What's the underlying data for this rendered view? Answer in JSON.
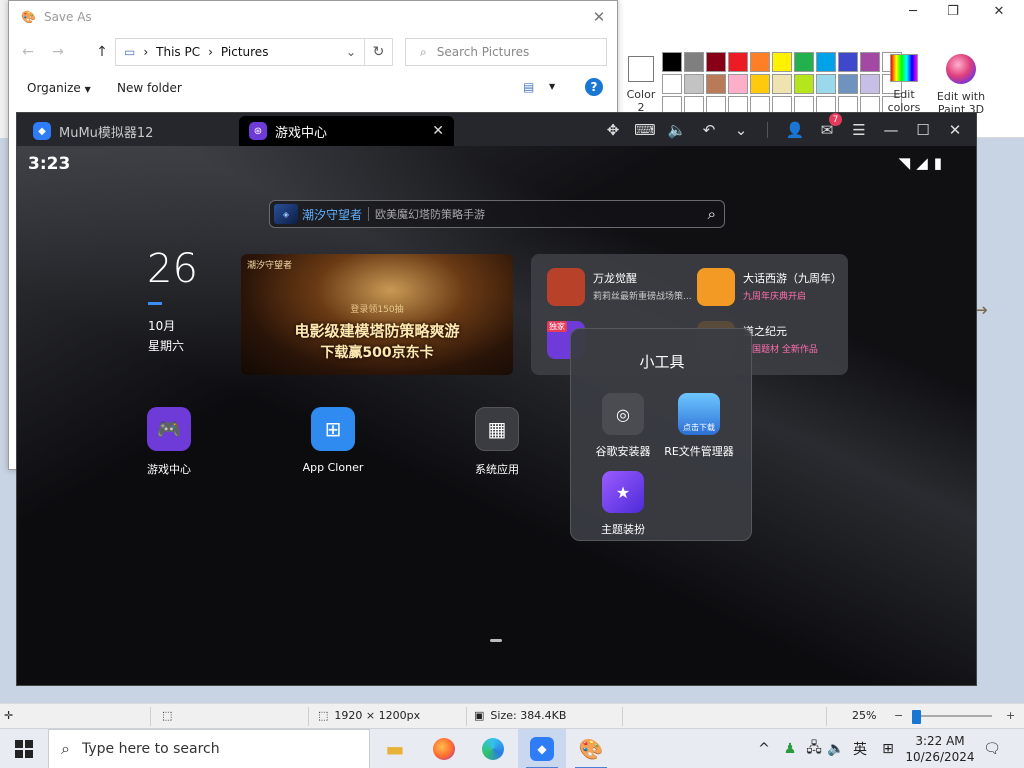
{
  "paint": {
    "window_controls": [
      "─",
      "❐",
      "✕"
    ],
    "color2_label": "Color 2",
    "palette": [
      "#000000",
      "#7f7f7f",
      "#880015",
      "#ed1c24",
      "#ff7f27",
      "#fff200",
      "#22b14c",
      "#00a2e8",
      "#3f48cc",
      "#a349a4",
      "#ffffff",
      "#ffffff",
      "#c3c3c3",
      "#b97a57",
      "#ffaec9",
      "#ffc90e",
      "#efe4b0",
      "#b5e61d",
      "#99d9ea",
      "#7092be",
      "#c8bfe7",
      "#ffffff",
      "#ffffff",
      "#ffffff",
      "#ffffff",
      "#ffffff",
      "#ffffff",
      "#ffffff",
      "#ffffff",
      "#ffffff",
      "#ffffff",
      "#ffffff",
      "#ffffff"
    ],
    "edit_colors_label": "Edit colors",
    "paint3d_label": "Edit with Paint 3D",
    "status": {
      "dimensions": "1920 × 1200px",
      "size": "Size: 384.4KB",
      "zoom": "25%",
      "zoom_fraction": 0.0
    }
  },
  "save_as": {
    "title": "Save As",
    "breadcrumb": [
      "This PC",
      "Pictures"
    ],
    "search_placeholder": "Search Pictures",
    "organize_label": "Organize",
    "new_folder_label": "New folder",
    "help_label": "?"
  },
  "mumu": {
    "tabs": [
      {
        "label": "MuMu模拟器12"
      },
      {
        "label": "游戏中心"
      }
    ],
    "mail_badge": "7",
    "status_time": "3:23",
    "search": {
      "brand": "潮汐守望者",
      "placeholder": "欧美魔幻塔防策略手游"
    },
    "date": {
      "day": "26",
      "month": "10月",
      "weekday": "星期六"
    },
    "banner": {
      "tag": "潮汐守望者",
      "subtitle": "登录领150抽",
      "line1": "电影级建模塔防策略爽游",
      "line2": "下载赢500京东卡"
    },
    "recommendations": [
      {
        "name": "万龙觉醒",
        "desc": "莉莉丝最新重磅战场策...",
        "color": "#b8412a",
        "desc_color": "#c9c9c9"
      },
      {
        "name": "大话西游（九周年）",
        "desc": "九周年庆典开启",
        "color": "#f29a24",
        "desc_color": "#ff6fb0"
      },
      {
        "name": "",
        "desc": "",
        "color": "#6f3bd8",
        "desc_color": "#c9c9c9"
      },
      {
        "name": "道之纪元",
        "desc": "三国题材 全新作品",
        "color": "#5a4a3a",
        "desc_color": "#ff6fb0"
      }
    ],
    "rec_badge": "独家",
    "apps": [
      {
        "label": "游戏中心",
        "icon": "gamepad-icon"
      },
      {
        "label": "App Cloner",
        "icon": "app-cloner-icon"
      },
      {
        "label": "系统应用",
        "icon": "system-apps-folder-icon"
      }
    ],
    "tools_popup": {
      "title": "小工具",
      "items": [
        {
          "label": "谷歌安装器",
          "icon": "google-installer-icon"
        },
        {
          "label": "RE文件管理器",
          "icon": "re-file-manager-icon",
          "sub": "点击下载"
        },
        {
          "label": "主题装扮",
          "icon": "theme-icon"
        }
      ]
    }
  },
  "taskbar": {
    "search_placeholder": "Type here to search",
    "ime_label": "英",
    "time": "3:22 AM",
    "date": "10/26/2024"
  }
}
